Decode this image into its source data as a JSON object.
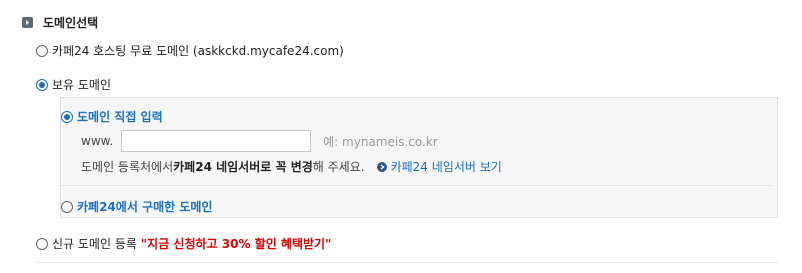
{
  "section": {
    "title": "도메인선택",
    "icon": "square-arrow-icon"
  },
  "options": {
    "free": {
      "label": "카페24 호스팅 무료 도메인 (askkckd.mycafe24.com)",
      "checked": false
    },
    "own": {
      "label": "보유 도메인",
      "checked": true
    },
    "new": {
      "label": "신규 도메인 등록",
      "promo": "\"지금 신청하고 30% 할인 혜택받기\"",
      "checked": false
    }
  },
  "own_panel": {
    "direct": {
      "label": "도메인 직접 입력",
      "checked": true
    },
    "www_label": "www.",
    "domain_value": "",
    "example": "예: mynameis.co.kr",
    "notice_prefix": "도메인 등록처에서 ",
    "notice_strong": "카페24 네임서버로 꼭 변경",
    "notice_suffix": "해 주세요.",
    "ns_link": "카페24 네임서버 보기",
    "cafe24": {
      "label": "카페24에서 구매한 도메인",
      "checked": false
    }
  },
  "colors": {
    "accent": "#1a6fc7",
    "promo": "#e00000",
    "panel_bg": "#f6f6f6"
  }
}
